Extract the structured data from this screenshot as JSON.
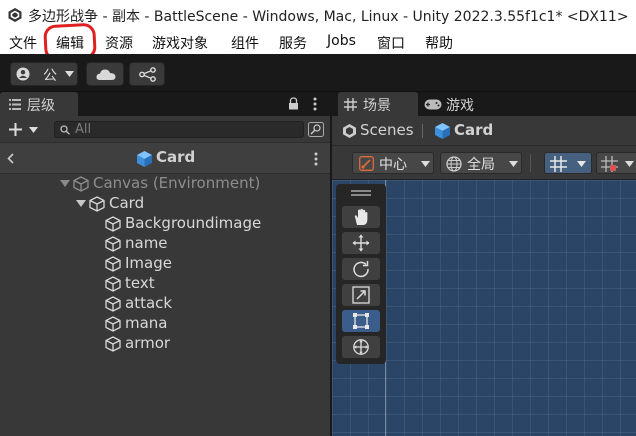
{
  "window": {
    "title": "多边形战争 - 副本 - BattleScene - Windows, Mac, Linux - Unity 2022.3.55f1c1* <DX11>"
  },
  "menu": {
    "items": [
      "文件",
      "编辑",
      "资源",
      "游戏对象",
      "组件",
      "服务",
      "Jobs",
      "窗口",
      "帮助"
    ]
  },
  "toolbar": {
    "account_label": "公"
  },
  "hierarchy": {
    "tab_label": "层级",
    "search_placeholder": "All",
    "breadcrumb": "Card",
    "tree": [
      {
        "label": "Canvas (Environment)",
        "depth": 0,
        "expanded": true,
        "dimmed": true
      },
      {
        "label": "Card",
        "depth": 1,
        "expanded": true,
        "dimmed": false
      },
      {
        "label": "Backgroundimage",
        "depth": 2,
        "dimmed": false
      },
      {
        "label": "name",
        "depth": 2,
        "dimmed": false
      },
      {
        "label": "Image",
        "depth": 2,
        "dimmed": false
      },
      {
        "label": "text",
        "depth": 2,
        "dimmed": false
      },
      {
        "label": "attack",
        "depth": 2,
        "dimmed": false
      },
      {
        "label": "mana",
        "depth": 2,
        "dimmed": false
      },
      {
        "label": "armor",
        "depth": 2,
        "dimmed": false
      }
    ]
  },
  "scene": {
    "tabs": [
      "场景",
      "游戏"
    ],
    "breadcrumb": [
      "Scenes",
      "Card"
    ],
    "pivot_label": "中心",
    "space_label": "全局",
    "tools": [
      "hand-tool-icon",
      "move-tool-icon",
      "rotate-tool-icon",
      "scale-tool-icon",
      "rect-tool-icon",
      "transform-tool-icon"
    ]
  },
  "colors": {
    "accent": "#4d9be6",
    "scene_bg": "#2b4566",
    "highlight": "#e02020"
  }
}
